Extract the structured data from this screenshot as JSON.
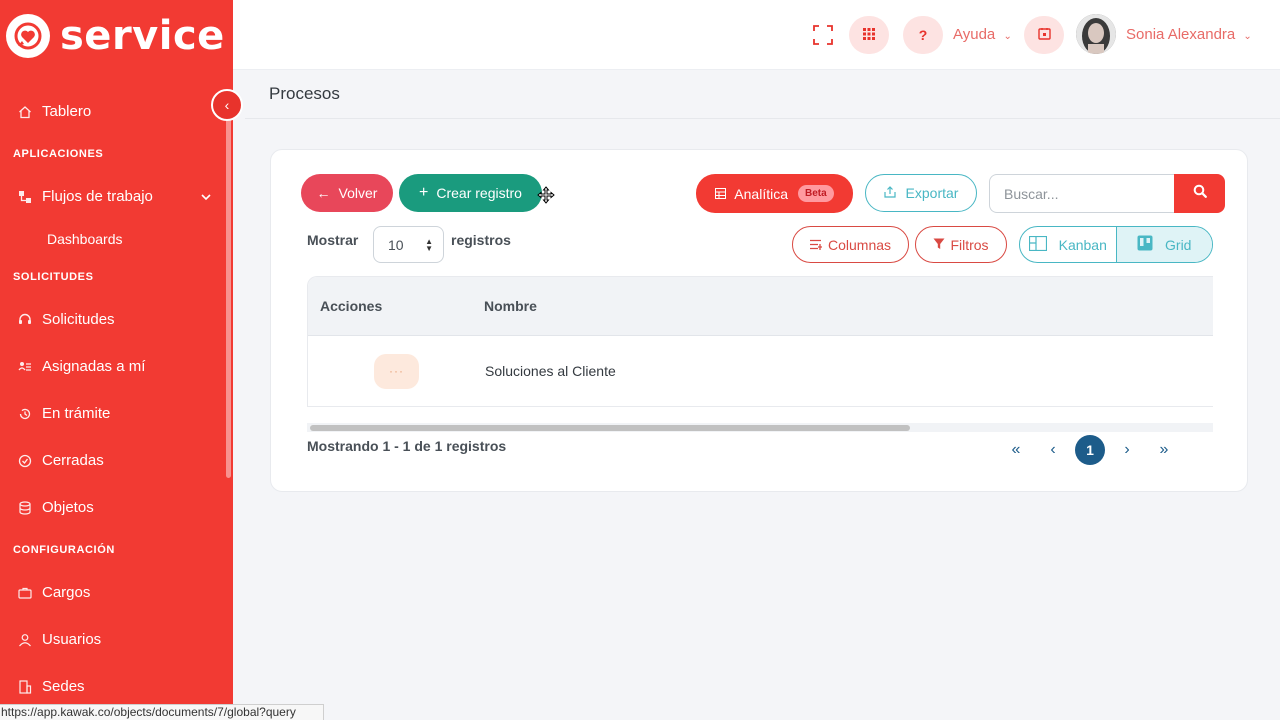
{
  "brand": {
    "name": "service"
  },
  "sidebar": {
    "items": [
      {
        "label": "Tablero",
        "icon": "home-icon"
      },
      {
        "section": "APLICACIONES"
      },
      {
        "label": "Flujos de trabajo",
        "icon": "workflow-icon"
      },
      {
        "sub": "Dashboards"
      },
      {
        "section": "SOLICITUDES"
      },
      {
        "label": "Solicitudes",
        "icon": "headset-icon"
      },
      {
        "label": "Asignadas a mí",
        "icon": "assigned-list-icon"
      },
      {
        "label": "En trámite",
        "icon": "history-icon"
      },
      {
        "label": "Cerradas",
        "icon": "check-circle-icon"
      },
      {
        "label": "Objetos",
        "icon": "database-icon"
      },
      {
        "section": "CONFIGURACIÓN"
      },
      {
        "label": "Cargos",
        "icon": "briefcase-icon"
      },
      {
        "label": "Usuarios",
        "icon": "user-icon"
      },
      {
        "label": "Sedes",
        "icon": "building-icon"
      }
    ]
  },
  "header": {
    "help_label": "Ayuda",
    "user_name": "Sonia Alexandra"
  },
  "page": {
    "title": "Procesos"
  },
  "toolbar": {
    "back_label": "Volver",
    "create_label": "Crear registro",
    "analytics_label": "Analítica",
    "analytics_badge": "Beta",
    "export_label": "Exportar",
    "search_placeholder": "Buscar...",
    "show_label": "Mostrar",
    "page_size": "10",
    "records_label": "registros",
    "columns_label": "Columnas",
    "filters_label": "Filtros",
    "kanban_label": "Kanban",
    "grid_label": "Grid"
  },
  "table": {
    "headers": [
      "Acciones",
      "Nombre"
    ],
    "rows": [
      {
        "actions": "···",
        "name": "Soluciones al Cliente"
      }
    ]
  },
  "footer": {
    "showing_text": "Mostrando 1 - 1 de 1 registros",
    "pager": [
      "«",
      "‹",
      "1",
      "›",
      "»"
    ],
    "current_page": "1"
  },
  "statusbar": {
    "url": "https://app.kawak.co/objects/documents/7/global?query"
  },
  "colors": {
    "primary": "#f23a33",
    "success": "#1a9b7e",
    "info": "#49b7c4",
    "pager_active": "#1d5c8a"
  }
}
